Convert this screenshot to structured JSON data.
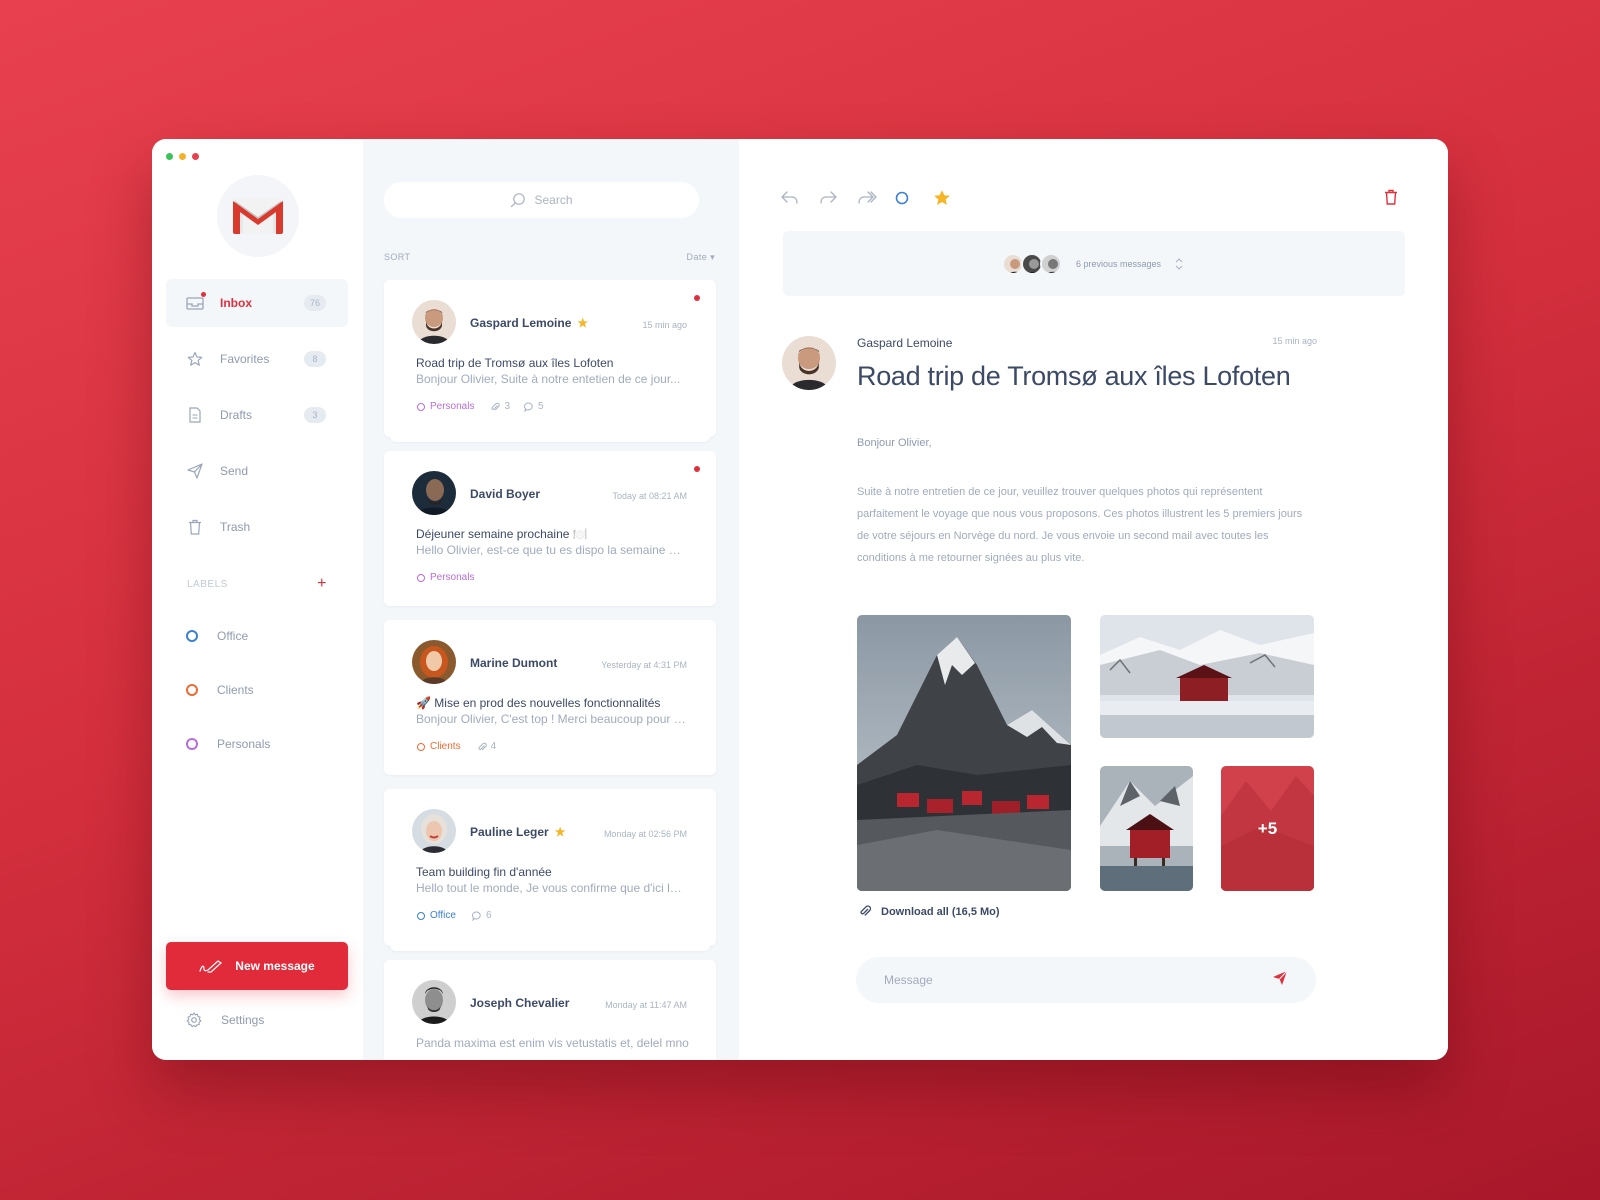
{
  "colors": {
    "accent": "#e0303e",
    "office": "#3b7fd6",
    "clients": "#f06a35",
    "personals": "#b86ed8",
    "star": "#f5b526"
  },
  "window_controls": [
    "green-dot",
    "yellow-dot",
    "red-dot"
  ],
  "sidebar": {
    "logo": "gmail-logo",
    "nav": [
      {
        "label": "Inbox",
        "count": "76",
        "icon": "inbox-icon",
        "active": true
      },
      {
        "label": "Favorites",
        "count": "8",
        "icon": "star-icon"
      },
      {
        "label": "Drafts",
        "count": "3",
        "icon": "document-icon"
      },
      {
        "label": "Send",
        "count": "",
        "icon": "paper-plane-icon"
      },
      {
        "label": "Trash",
        "count": "",
        "icon": "trash-icon"
      }
    ],
    "labels_title": "LABELS",
    "labels_add": "+",
    "labels": [
      {
        "label": "Office",
        "color": "#3b7fd6"
      },
      {
        "label": "Clients",
        "color": "#f06a35"
      },
      {
        "label": "Personals",
        "color": "#b86ed8"
      }
    ],
    "new_message": "New message",
    "settings": "Settings"
  },
  "list": {
    "search_placeholder": "Search",
    "sort_label": "SORT",
    "sort_value": "Date",
    "messages": [
      {
        "name": "Gaspard Lemoine",
        "starred": true,
        "time": "15 min ago",
        "unread": true,
        "subject": "Road trip de Tromsø aux îles Lofoten",
        "preview": "Bonjour Olivier, Suite à notre entetien de ce jour...",
        "tag": "Personals",
        "tag_color": "#b86ed8",
        "attachments": "3",
        "comments": "5"
      },
      {
        "name": "David Boyer",
        "starred": false,
        "time": "Today at 08:21 AM",
        "unread": true,
        "subject": "Déjeuner semaine prochaine 🍽️",
        "preview": "Hello Olivier, est-ce que tu es dispo la semaine pr...",
        "tag": "Personals",
        "tag_color": "#b86ed8",
        "attachments": "",
        "comments": ""
      },
      {
        "name": "Marine Dumont",
        "starred": false,
        "time": "Yesterday at 4:31 PM",
        "unread": false,
        "subject": "🚀 Mise en prod des nouvelles fonctionnalités",
        "preview": "Bonjour Olivier, C'est top ! Merci beaucoup pour to...",
        "tag": "Clients",
        "tag_color": "#f06a35",
        "attachments": "4",
        "comments": ""
      },
      {
        "name": "Pauline Leger",
        "starred": true,
        "time": "Monday at 02:56 PM",
        "unread": false,
        "subject": "Team building fin d'année",
        "preview": "Hello tout le monde, Je vous confirme que d'ici la f...",
        "tag": "Office",
        "tag_color": "#3b7fd6",
        "attachments": "",
        "comments": "6"
      },
      {
        "name": "Joseph Chevalier",
        "starred": false,
        "time": "Monday at 11:47 AM",
        "unread": false,
        "subject": "Panda maxima est enim vis vetustatis et, delel mno",
        "preview": "",
        "tag": "",
        "tag_color": "",
        "attachments": "",
        "comments": ""
      }
    ]
  },
  "reader": {
    "toolbar": [
      "reply-icon",
      "reply-all-icon",
      "forward-icon",
      "mark-unread-icon",
      "star-icon"
    ],
    "previous_messages": "6 previous messages",
    "sender": "Gaspard Lemoine",
    "time": "15 min ago",
    "title": "Road trip de Tromsø aux îles Lofoten",
    "greeting": "Bonjour Olivier,",
    "body": "Suite à notre entretien de ce jour, veuillez trouver quelques photos qui représentent parfaitement le voyage que nous vous proposons. Ces photos illustrent les 5 premiers jours de votre séjours en Norvège du nord. Je vous envoie un second mail avec toutes les conditions à me retourner signées au plus vite.",
    "more_photos": "+5",
    "download": "Download all (16,5 Mo)",
    "compose_placeholder": "Message"
  }
}
